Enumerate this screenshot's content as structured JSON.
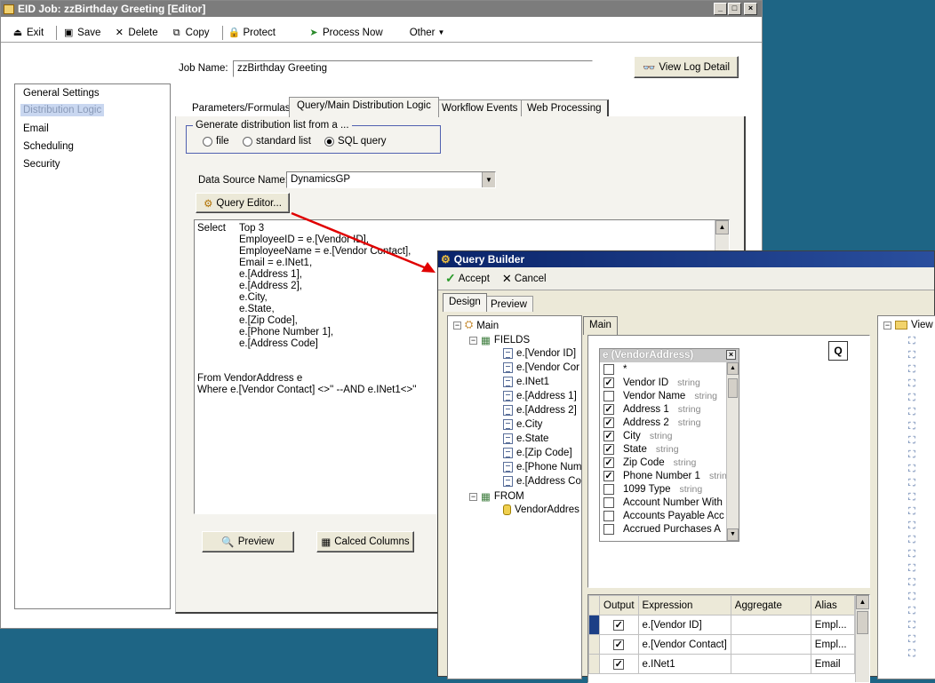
{
  "editor": {
    "title": "EID Job: zzBirthday Greeting [Editor]",
    "toolbar": {
      "exit": "Exit",
      "save": "Save",
      "delete": "Delete",
      "copy": "Copy",
      "protect": "Protect",
      "process_now": "Process Now",
      "other": "Other"
    },
    "job_name_label": "Job Name:",
    "job_name_value": "zzBirthday Greeting",
    "view_log_label": "View Log Detail",
    "sidebar": [
      "General Settings",
      "Distribution Logic",
      "Email",
      "Scheduling",
      "Security"
    ],
    "tabs": [
      "Parameters/Formulas",
      "Query/Main Distribution Logic",
      "Workflow Events",
      "Web Processing"
    ],
    "generate_legend": "Generate distribution list from a ...",
    "radio": {
      "file": "file",
      "standard": "standard list",
      "sql": "SQL query"
    },
    "datasource_label": "Data Source Name:",
    "datasource_value": "DynamicsGP",
    "query_editor_label": "Query Editor...",
    "sql_lines": {
      "select": "Select",
      "l1": "Top 3",
      "l2": "EmployeeID = e.[Vendor ID],",
      "l3": "EmployeeName = e.[Vendor Contact],",
      "l4": "Email = e.INet1,",
      "l5": "e.[Address 1],",
      "l6": "e.[Address 2],",
      "l7": "e.City,",
      "l8": "e.State,",
      "l9": "e.[Zip Code],",
      "l10": "e.[Phone Number 1],",
      "l11": "e.[Address Code]",
      "from": "From VendorAddress e",
      "where": "Where e.[Vendor Contact] <>''  --AND e.INet1<>''"
    },
    "preview_label": "Preview",
    "calced_label": "Calced Columns"
  },
  "builder": {
    "title": "Query Builder",
    "accept": "Accept",
    "cancel": "Cancel",
    "tabs": [
      "Design",
      "Preview"
    ],
    "tree": {
      "main": "Main",
      "fields": "FIELDS",
      "field_items": [
        "e.[Vendor ID]",
        "e.[Vendor Cor",
        "e.INet1",
        "e.[Address 1]",
        "e.[Address 2]",
        "e.City",
        "e.State",
        "e.[Zip Code]",
        "e.[Phone Num",
        "e.[Address Co"
      ],
      "from": "FROM",
      "from_item": "VendorAddres"
    },
    "canvas_tab": "Main",
    "q_label": "Q",
    "table_title": "e (VendorAddress)",
    "columns": [
      {
        "name": "*",
        "type": "",
        "checked": false
      },
      {
        "name": "Vendor ID",
        "type": "string",
        "checked": true
      },
      {
        "name": "Vendor Name",
        "type": "string",
        "checked": false
      },
      {
        "name": "Address 1",
        "type": "string",
        "checked": true
      },
      {
        "name": "Address 2",
        "type": "string",
        "checked": true
      },
      {
        "name": "City",
        "type": "string",
        "checked": true
      },
      {
        "name": "State",
        "type": "string",
        "checked": true
      },
      {
        "name": "Zip Code",
        "type": "string",
        "checked": true
      },
      {
        "name": "Phone Number 1",
        "type": "strin",
        "checked": true
      },
      {
        "name": "1099 Type",
        "type": "string",
        "checked": false
      },
      {
        "name": "Account Number With",
        "type": "",
        "checked": false
      },
      {
        "name": "Accounts Payable Acc",
        "type": "",
        "checked": false
      },
      {
        "name": "Accrued Purchases A",
        "type": "",
        "checked": false
      }
    ],
    "grid_headers": [
      "Output",
      "Expression",
      "Aggregate",
      "Alias"
    ],
    "grid_rows": [
      {
        "expr": "e.[Vendor ID]",
        "alias": "Empl..."
      },
      {
        "expr": "e.[Vendor Contact]",
        "alias": "Empl..."
      },
      {
        "expr": "e.INet1",
        "alias": "Email"
      }
    ],
    "right_tree_label": "View"
  }
}
